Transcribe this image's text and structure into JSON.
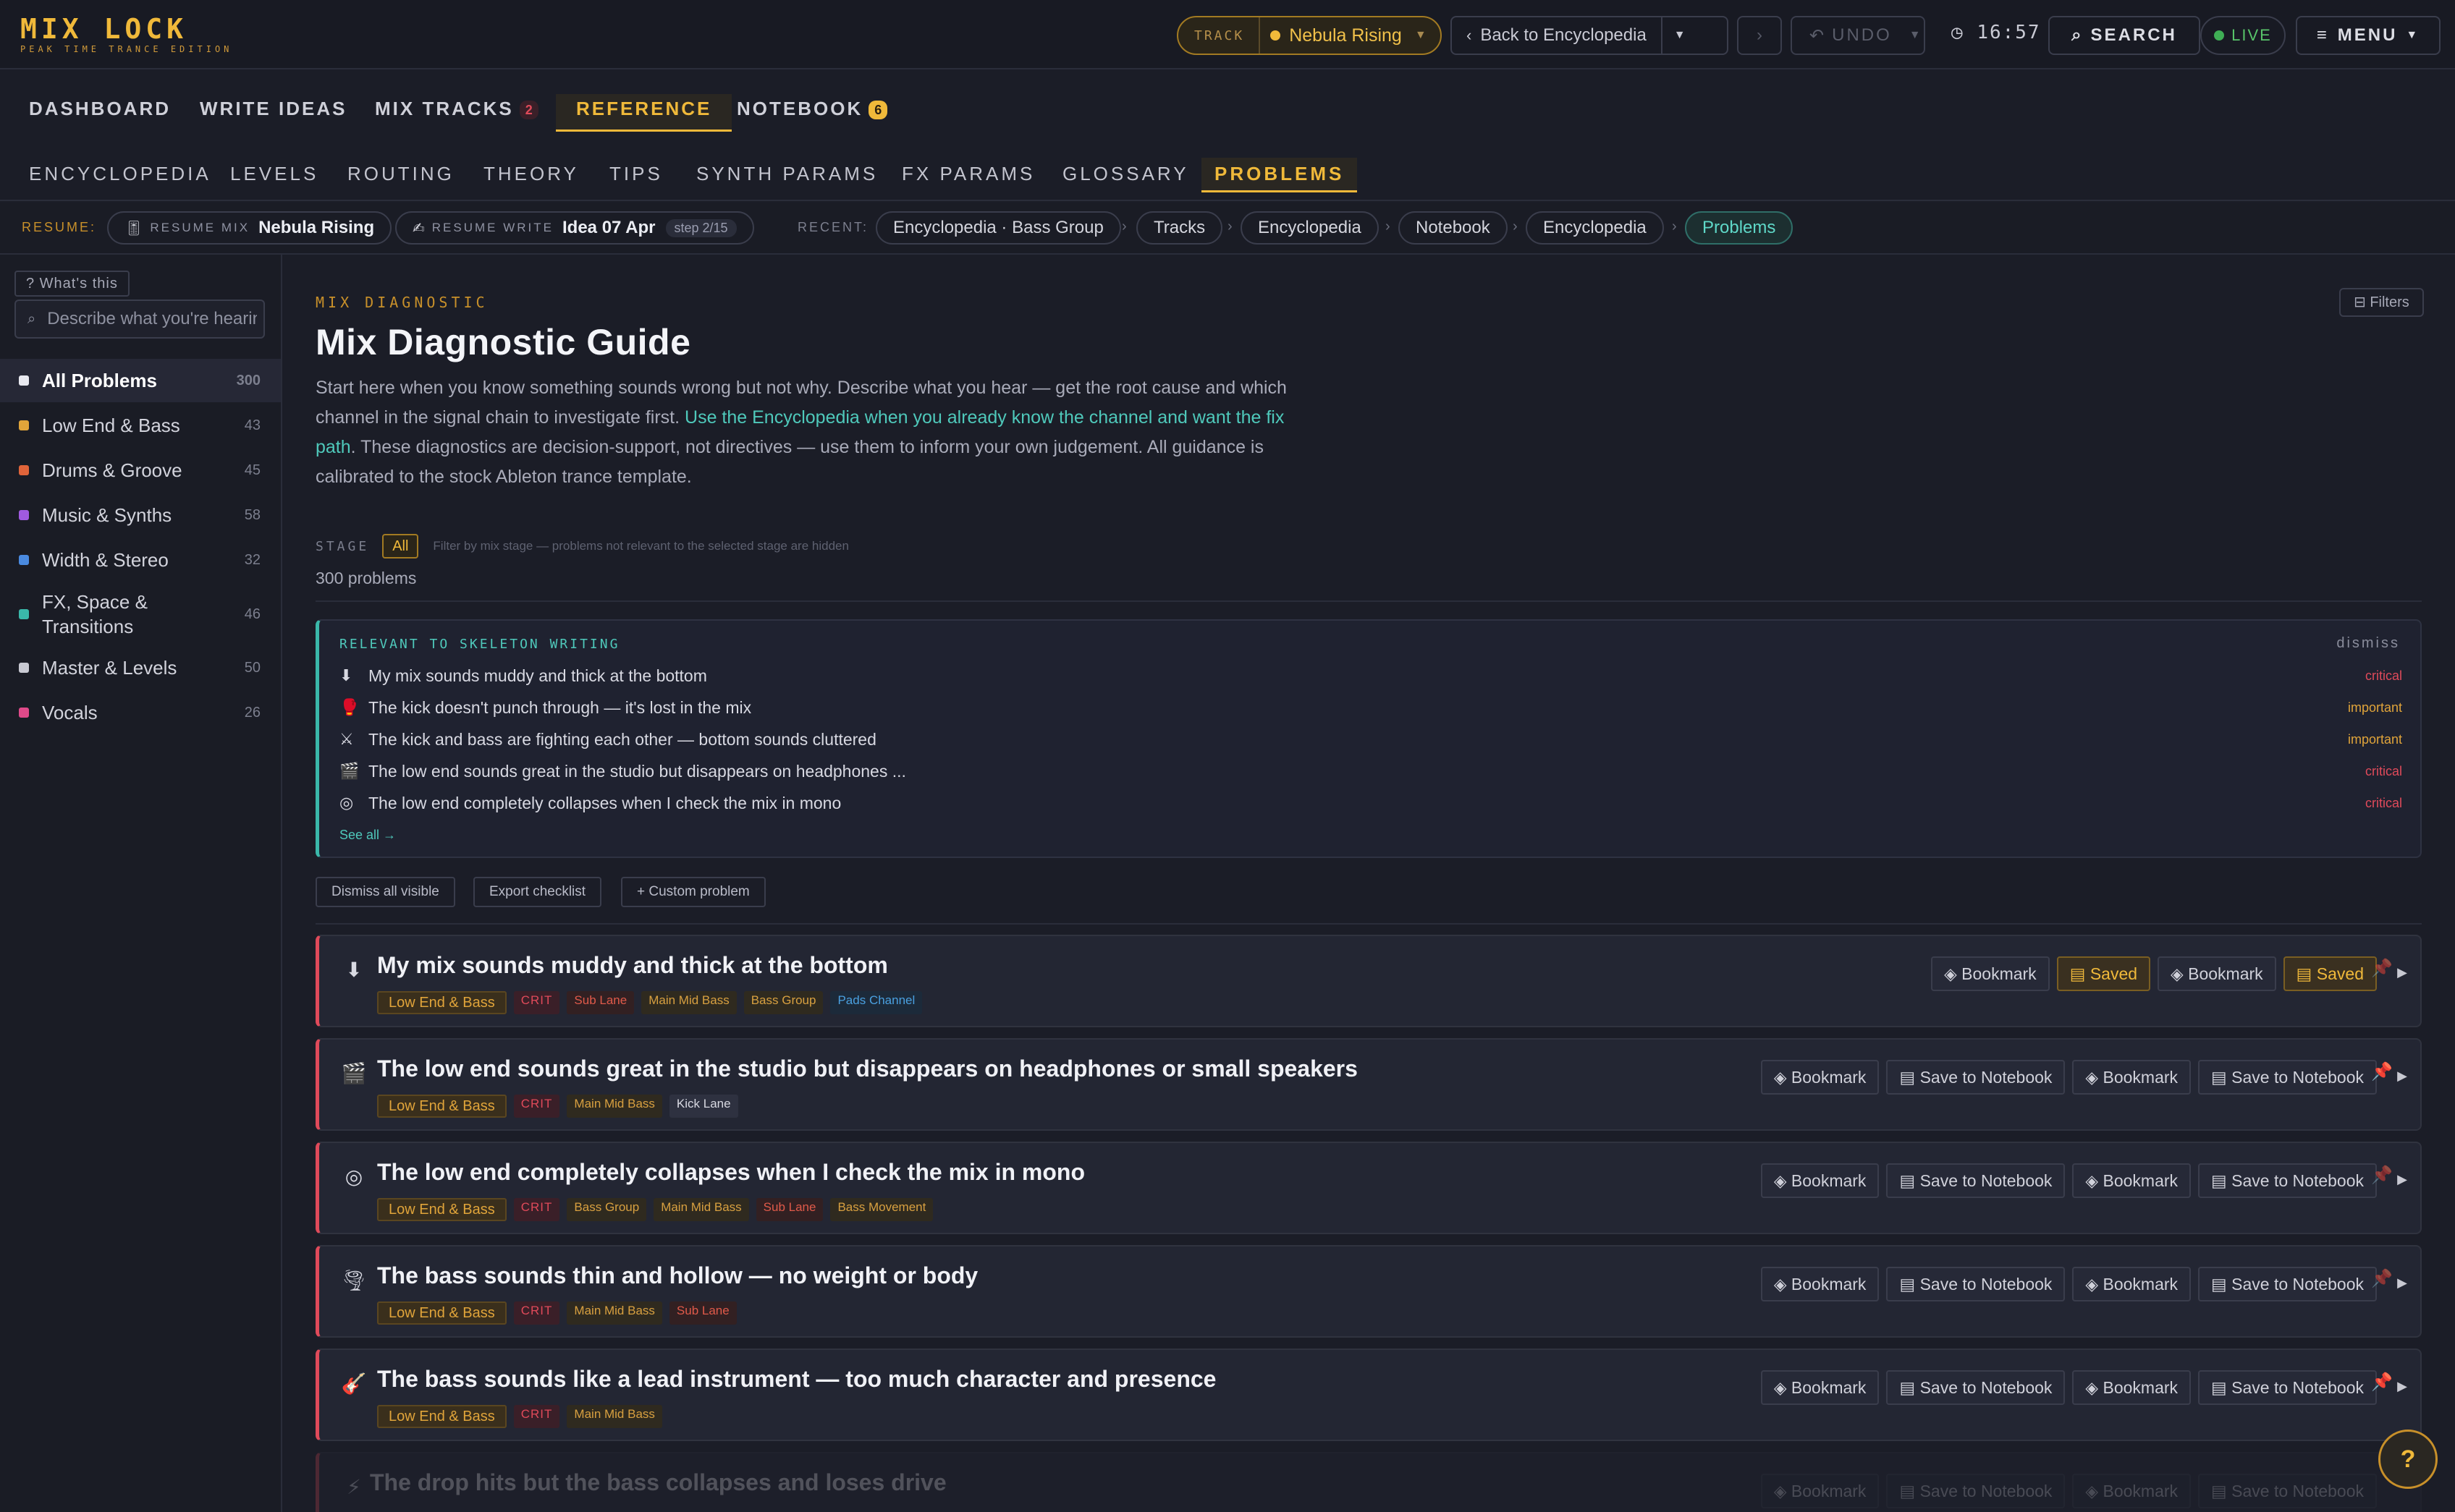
{
  "logo": {
    "title": "MIX LOCK",
    "subtitle": "PEAK TIME TRANCE EDITION"
  },
  "topbar": {
    "track_label": "TRACK",
    "track_name": "Nebula Rising",
    "back_label": "Back to Encyclopedia",
    "undo_label": "UNDO",
    "clock": "16:57",
    "search_label": "SEARCH",
    "live_label": "LIVE",
    "menu_label": "MENU"
  },
  "mainnav": {
    "tabs": [
      {
        "label": "DASHBOARD"
      },
      {
        "label": "WRITE IDEAS"
      },
      {
        "label": "MIX TRACKS",
        "badge": "2"
      },
      {
        "label": "REFERENCE"
      },
      {
        "label": "NOTEBOOK",
        "badge": "6"
      }
    ]
  },
  "subnav": {
    "tabs": [
      "ENCYCLOPEDIA",
      "LEVELS",
      "ROUTING",
      "THEORY",
      "TIPS",
      "SYNTH PARAMS",
      "FX PARAMS",
      "GLOSSARY",
      "PROBLEMS"
    ]
  },
  "resume": {
    "label": "RESUME:",
    "mix": {
      "small": "RESUME MIX",
      "name": "Nebula Rising"
    },
    "write": {
      "small": "RESUME WRITE",
      "name": "Idea 07 Apr",
      "step": "step 2/15"
    },
    "recent_label": "RECENT:",
    "recent": [
      "Encyclopedia · Bass Group",
      "Tracks",
      "Encyclopedia",
      "Notebook",
      "Encyclopedia",
      "Problems"
    ]
  },
  "sidebar": {
    "whats_this": "? What's this",
    "search_placeholder": "Describe what you're hearing...",
    "categories": [
      {
        "name": "All Problems",
        "count": "300",
        "color": "#e8e9f0"
      },
      {
        "name": "Low End & Bass",
        "count": "43",
        "color": "#e0a43a"
      },
      {
        "name": "Drums & Groove",
        "count": "45",
        "color": "#e0643a"
      },
      {
        "name": "Music & Synths",
        "count": "58",
        "color": "#a05ae0"
      },
      {
        "name": "Width & Stereo",
        "count": "32",
        "color": "#4a8ae0"
      },
      {
        "name": "FX, Space & Transitions",
        "count": "46",
        "color": "#3ab8aa"
      },
      {
        "name": "Master & Levels",
        "count": "50",
        "color": "#c8c9d2"
      },
      {
        "name": "Vocals",
        "count": "26",
        "color": "#e04a8a"
      }
    ]
  },
  "main": {
    "eyebrow": "MIX DIAGNOSTIC",
    "filters_label": "⊟ Filters",
    "title": "Mix Diagnostic Guide",
    "intro_a": "Start here when you know something sounds wrong but not why. Describe what you hear — get the root cause and which channel in the signal chain to investigate first. ",
    "intro_link": "Use the Encyclopedia when you already know the channel and want the fix path",
    "intro_b": ". These diagnostics are decision-support, not directives — use them to inform your own judgement. All guidance is calibrated to the stock Ableton trance template.",
    "stage_label": "STAGE",
    "stage_value": "All",
    "stage_hint": "Filter by mix stage — problems not relevant to the selected stage are hidden",
    "count": "300 problems"
  },
  "relevant": {
    "head": "RELEVANT TO SKELETON WRITING",
    "dismiss": "dismiss",
    "see_all": "See all →",
    "items": [
      {
        "icon": "⬇",
        "text": "My mix sounds muddy and thick at the bottom",
        "sev": "critical"
      },
      {
        "icon": "🥊",
        "text": "The kick doesn't punch through — it's lost in the mix",
        "sev": "important"
      },
      {
        "icon": "⚔",
        "text": "The kick and bass are fighting each other — bottom sounds cluttered",
        "sev": "important"
      },
      {
        "icon": "🎬",
        "text": "The low end sounds great in the studio but disappears on headphones ...",
        "sev": "critical"
      },
      {
        "icon": "◎",
        "text": "The low end completely collapses when I check the mix in mono",
        "sev": "critical"
      }
    ]
  },
  "actions": {
    "dismiss_all": "Dismiss all visible",
    "export": "Export checklist",
    "custom": "+ Custom problem"
  },
  "buttons": {
    "bookmark": "Bookmark",
    "saved": "Saved",
    "save_to_notebook": "Save to Notebook"
  },
  "cards": [
    {
      "icon": "⬇",
      "title": "My mix sounds muddy and thick at the bottom",
      "cat": "Low End & Bass",
      "crit": "CRIT",
      "tags": [
        {
          "t": "Sub Lane",
          "c": "ch-red"
        },
        {
          "t": "Main Mid Bass",
          "c": "ch-amber"
        },
        {
          "t": "Bass Group",
          "c": "ch-amber"
        },
        {
          "t": "Pads Channel",
          "c": "ch-blue"
        }
      ],
      "saved": true
    },
    {
      "icon": "🎬",
      "title": "The low end sounds great in the studio but disappears on headphones or small speakers",
      "cat": "Low End & Bass",
      "crit": "CRIT",
      "tags": [
        {
          "t": "Main Mid Bass",
          "c": "ch-amber"
        },
        {
          "t": "Kick Lane",
          "c": "ch-white"
        }
      ],
      "saved": false
    },
    {
      "icon": "◎",
      "title": "The low end completely collapses when I check the mix in mono",
      "cat": "Low End & Bass",
      "crit": "CRIT",
      "tags": [
        {
          "t": "Bass Group",
          "c": "ch-amber"
        },
        {
          "t": "Main Mid Bass",
          "c": "ch-amber"
        },
        {
          "t": "Sub Lane",
          "c": "ch-red"
        },
        {
          "t": "Bass Movement",
          "c": "ch-amber"
        }
      ],
      "saved": false
    },
    {
      "icon": "🌪",
      "title": "The bass sounds thin and hollow — no weight or body",
      "cat": "Low End & Bass",
      "crit": "CRIT",
      "tags": [
        {
          "t": "Main Mid Bass",
          "c": "ch-amber"
        },
        {
          "t": "Sub Lane",
          "c": "ch-red"
        }
      ],
      "saved": false
    },
    {
      "icon": "🎸",
      "title": "The bass sounds like a lead instrument — too much character and presence",
      "cat": "Low End & Bass",
      "crit": "CRIT",
      "tags": [
        {
          "t": "Main Mid Bass",
          "c": "ch-amber"
        }
      ],
      "saved": false
    },
    {
      "icon": "⚡",
      "title": "The drop hits but the bass collapses and loses drive",
      "cat": "",
      "crit": "",
      "tags": [],
      "saved": false
    }
  ]
}
